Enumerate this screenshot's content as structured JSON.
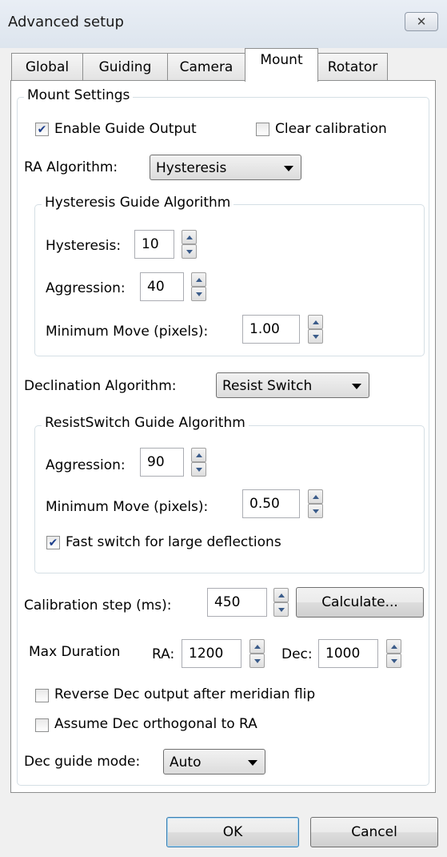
{
  "window": {
    "title": "Advanced setup",
    "close_glyph": "✕"
  },
  "tabs": [
    {
      "label": "Global",
      "active": false
    },
    {
      "label": "Guiding",
      "active": false
    },
    {
      "label": "Camera",
      "active": false
    },
    {
      "label": "Mount",
      "active": true
    },
    {
      "label": "Rotator",
      "active": false
    }
  ],
  "mount_settings": {
    "group_title": "Mount Settings",
    "enable_guide_output": {
      "label": "Enable Guide Output",
      "checked": true
    },
    "clear_calibration": {
      "label": "Clear calibration",
      "checked": false
    },
    "ra_algorithm": {
      "label": "RA Algorithm:",
      "value": "Hysteresis"
    },
    "hysteresis_group": {
      "title": "Hysteresis Guide Algorithm",
      "hysteresis": {
        "label": "Hysteresis:",
        "value": "10"
      },
      "aggression": {
        "label": "Aggression:",
        "value": "40"
      },
      "min_move": {
        "label": "Minimum Move (pixels):",
        "value": "1.00"
      }
    },
    "dec_algorithm": {
      "label": "Declination Algorithm:",
      "value": "Resist Switch"
    },
    "resistswitch_group": {
      "title": "ResistSwitch Guide Algorithm",
      "aggression": {
        "label": "Aggression:",
        "value": "90"
      },
      "min_move": {
        "label": "Minimum Move (pixels):",
        "value": "0.50"
      },
      "fast_switch": {
        "label": "Fast switch for large deflections",
        "checked": true
      }
    },
    "calibration_step": {
      "label": "Calibration step (ms):",
      "value": "450",
      "button": "Calculate..."
    },
    "max_duration": {
      "label": "Max Duration",
      "ra_label": "RA:",
      "ra_value": "1200",
      "dec_label": "Dec:",
      "dec_value": "1000"
    },
    "reverse_dec": {
      "label": "Reverse Dec output after meridian flip",
      "checked": false
    },
    "assume_orthogonal": {
      "label": "Assume Dec orthogonal to RA",
      "checked": false
    },
    "dec_guide_mode": {
      "label": "Dec guide mode:",
      "value": "Auto"
    }
  },
  "footer": {
    "ok": "OK",
    "cancel": "Cancel"
  },
  "icons": {
    "check": "✔"
  }
}
